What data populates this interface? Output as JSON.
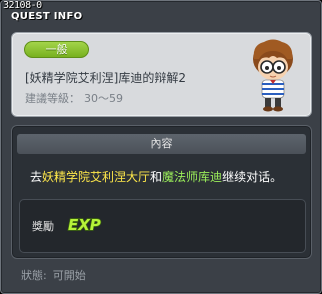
{
  "window": {
    "quest_id": "32108-0",
    "title": "QUEST INFO"
  },
  "header": {
    "category": "一般",
    "quest_name": "[妖精学院艾利涅]库迪的辩解2",
    "rec_level_label": "建議等級：",
    "rec_level_value": "30～59"
  },
  "content": {
    "header": "內容",
    "text_parts": [
      "去",
      "妖精学院艾利涅大厅",
      "和",
      "魔法师库迪",
      "继续对话。"
    ]
  },
  "reward": {
    "label": "獎勵",
    "icon": "exp-icon",
    "icon_text": "EXP"
  },
  "status": {
    "label": "狀態:",
    "value": "可開始"
  },
  "colors": {
    "badge_green": "#8cc63f",
    "highlight_yellow": "#ffe84a",
    "highlight_green": "#9cf05a"
  }
}
